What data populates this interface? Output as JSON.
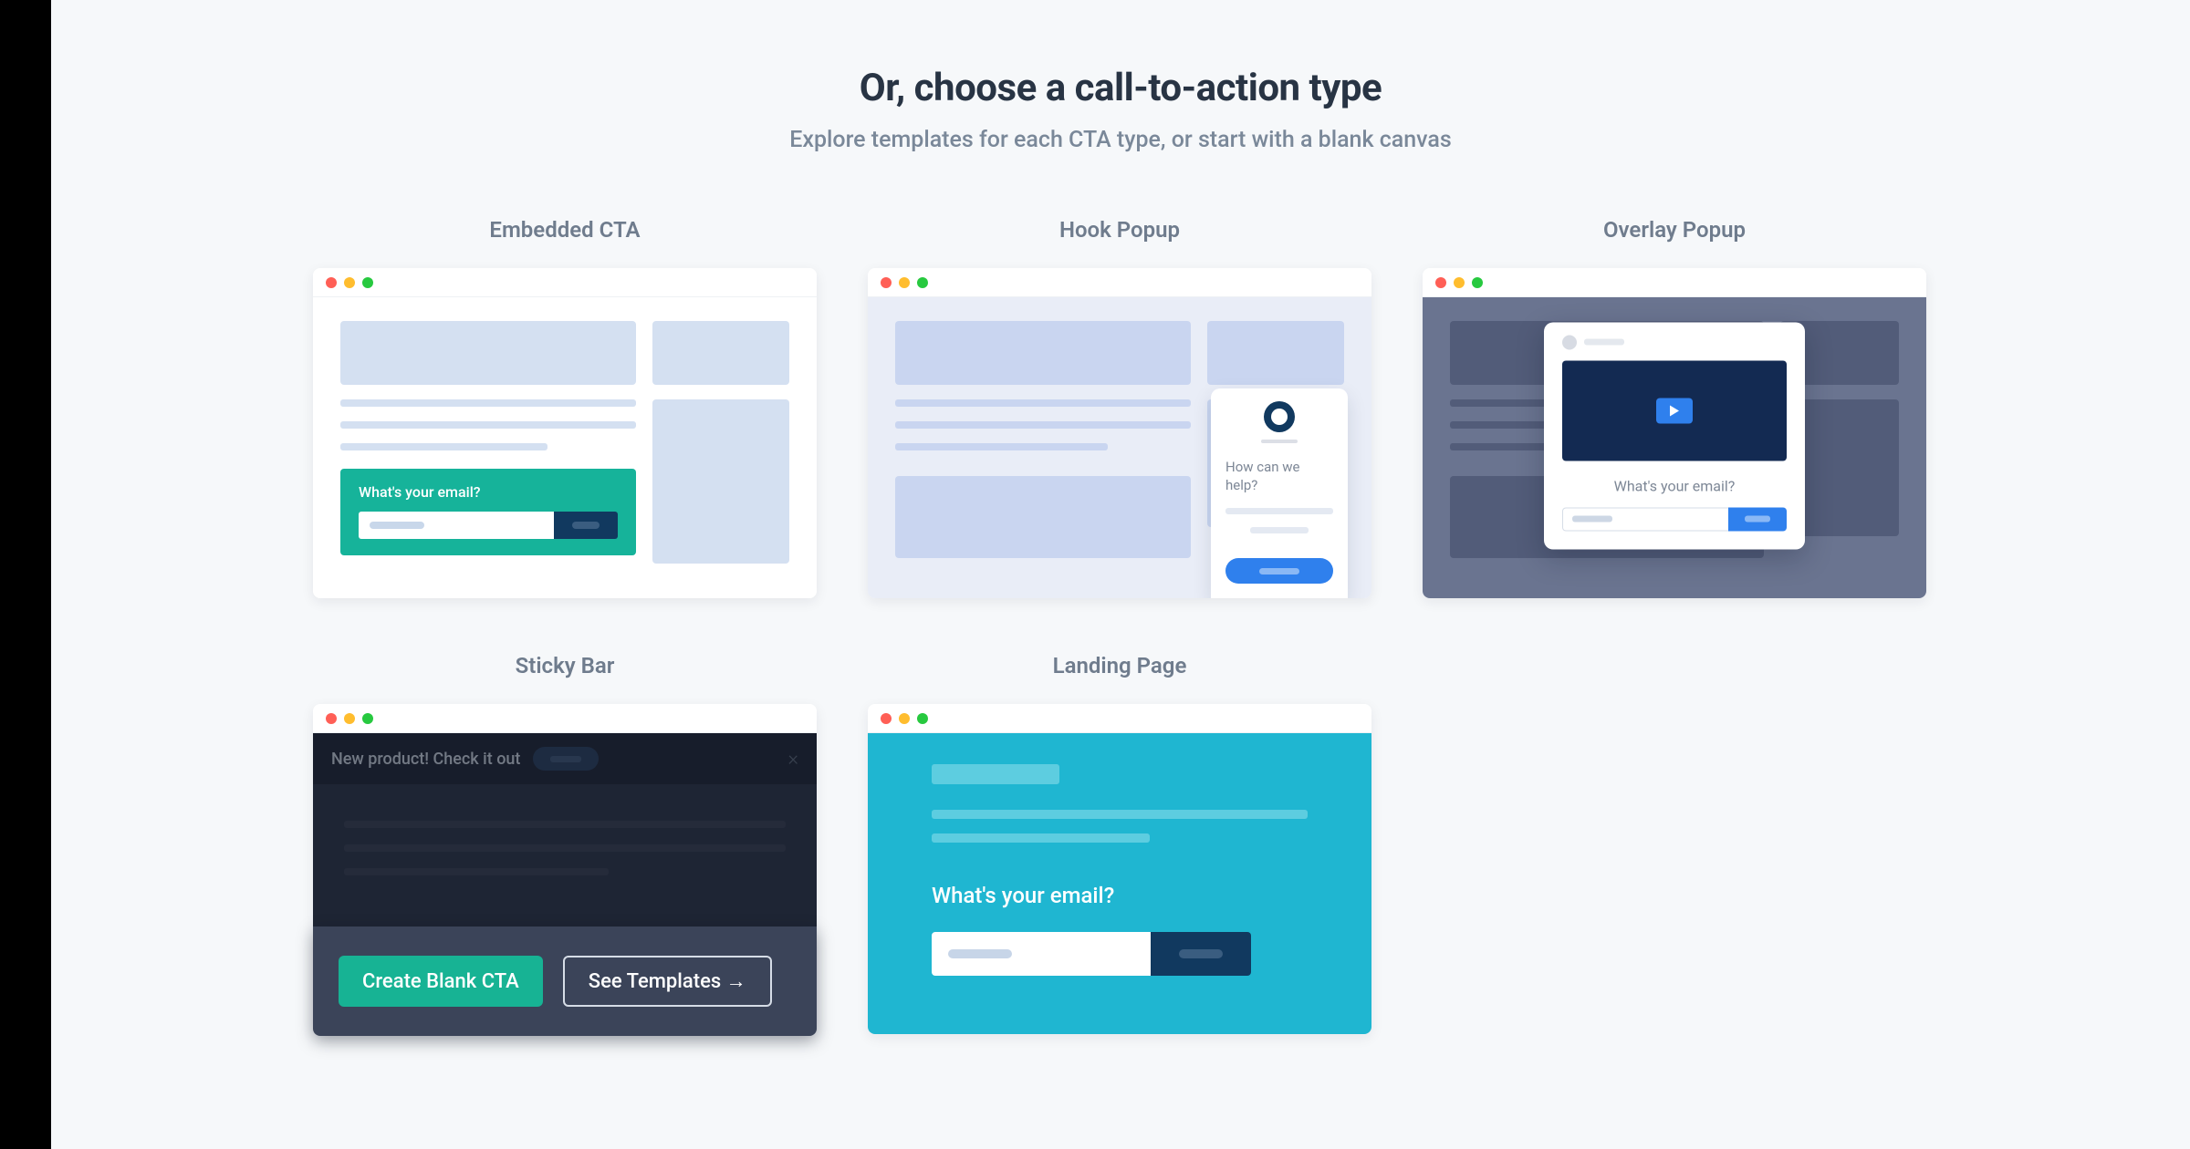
{
  "header": {
    "title": "Or, choose a call-to-action type",
    "subtitle": "Explore templates for each CTA type, or start with a blank canvas"
  },
  "cards": {
    "embedded": {
      "label": "Embedded CTA",
      "form_label": "What's your email?"
    },
    "hook": {
      "label": "Hook Popup",
      "prompt": "How can we help?"
    },
    "overlay": {
      "label": "Overlay Popup",
      "form_label": "What's your email?"
    },
    "sticky": {
      "label": "Sticky Bar",
      "bar_text": "New product!  Check it out"
    },
    "landing": {
      "label": "Landing Page",
      "form_label": "What's your email?"
    }
  },
  "hover_actions": {
    "create_blank": "Create Blank CTA",
    "see_templates": "See Templates →"
  },
  "colors": {
    "page_bg": "#f6f8fa",
    "teal": "#16b39a",
    "blue": "#2f80ed",
    "navy": "#11395f",
    "cyan": "#1fb6d1",
    "dark_panel": "#3b4459"
  }
}
